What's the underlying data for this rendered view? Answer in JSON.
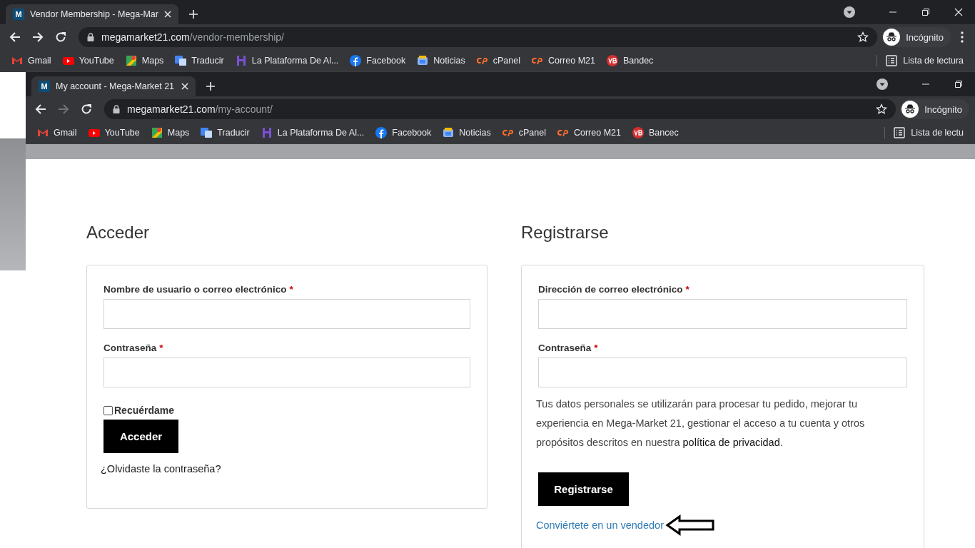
{
  "outer_browser": {
    "tabs": [
      {
        "favicon_letter": "M",
        "title": "Vendor Membership - Mega-Mar",
        "selected": true
      }
    ],
    "address": {
      "domain": "megamarket21.com",
      "path": "/vendor-membership/"
    },
    "forward_enabled": true,
    "profile_label": "Incógnito",
    "window_controls": [
      {
        "kind": "minimize"
      },
      {
        "kind": "restore"
      },
      {
        "kind": "close"
      }
    ],
    "menu": true,
    "bookmarks": [
      {
        "label": "Gmail",
        "kind": "gmail"
      },
      {
        "label": "YouTube",
        "kind": "youtube"
      },
      {
        "label": "Maps",
        "kind": "maps"
      },
      {
        "label": "Traducir",
        "kind": "translate"
      },
      {
        "label": "La Plataforma De Al...",
        "kind": "platform"
      },
      {
        "label": "Facebook",
        "kind": "facebook"
      },
      {
        "label": "Noticias",
        "kind": "news"
      },
      {
        "label": "cPanel",
        "kind": "cpanel"
      },
      {
        "label": "Correo M21",
        "kind": "cpanel"
      },
      {
        "label": "Bandec",
        "kind": "bank"
      }
    ],
    "reading_list": "Lista de lectura"
  },
  "inner_browser": {
    "tabs": [
      {
        "favicon_letter": "M",
        "title": "My account - Mega-Market 21",
        "selected": true
      }
    ],
    "address": {
      "domain": "megamarket21.com",
      "path": "/my-account/"
    },
    "forward_enabled": false,
    "profile_label": "Incógnito",
    "window_controls": [
      {
        "kind": "minimize"
      },
      {
        "kind": "restore"
      }
    ],
    "menu": false,
    "bookmarks": [
      {
        "label": "Gmail",
        "kind": "gmail"
      },
      {
        "label": "YouTube",
        "kind": "youtube"
      },
      {
        "label": "Maps",
        "kind": "maps"
      },
      {
        "label": "Traducir",
        "kind": "translate"
      },
      {
        "label": "La Plataforma De Al...",
        "kind": "platform"
      },
      {
        "label": "Facebook",
        "kind": "facebook"
      },
      {
        "label": "Noticias",
        "kind": "news"
      },
      {
        "label": "cPanel",
        "kind": "cpanel"
      },
      {
        "label": "Correo M21",
        "kind": "cpanel"
      },
      {
        "label": "Bancec",
        "kind": "bank"
      }
    ],
    "reading_list": "Lista de lectu"
  },
  "login": {
    "heading": "Acceder",
    "fields": [
      {
        "label": "Nombre de usuario o correo electrónico",
        "required_mark": "*"
      },
      {
        "label": "Contraseña",
        "required_mark": "*"
      }
    ],
    "remember": {
      "label": "Recuérdame",
      "checked": false
    },
    "button": "Acceder",
    "lost_password": "¿Olvidaste la contraseña?"
  },
  "register": {
    "heading": "Registrarse",
    "fields": [
      {
        "label": "Dirección de correo electrónico",
        "required_mark": "*"
      },
      {
        "label": "Contraseña",
        "required_mark": "*"
      }
    ],
    "privacy": {
      "text_before": "Tus datos personales se utilizarán para procesar tu pedido, mejorar tu experiencia en Mega-Market 21, gestionar el acceso a tu cuenta y otros propósitos descritos en nuestra ",
      "link": "política de privacidad",
      "text_after": "."
    },
    "button": "Registrarse",
    "vendor_link": "Conviértete en un vendedor"
  }
}
